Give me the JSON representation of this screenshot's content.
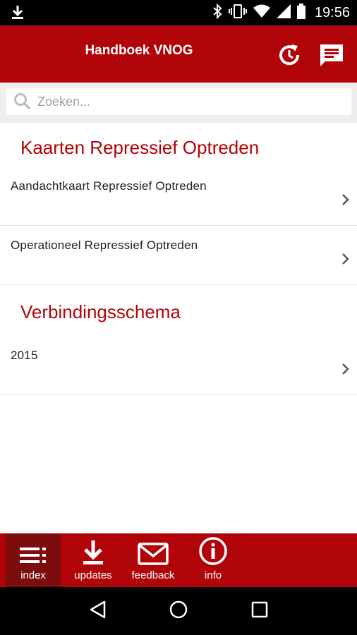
{
  "status_bar": {
    "time": "19:56",
    "icons": [
      "download-icon",
      "bluetooth-icon",
      "vibrate-icon",
      "wifi-icon",
      "signal-icon",
      "battery-icon"
    ]
  },
  "app_bar": {
    "title": "Handboek VNOG",
    "actions": [
      "refresh-history-icon",
      "chat-icon"
    ]
  },
  "search": {
    "placeholder": "Zoeken..."
  },
  "sections": [
    {
      "title": "Kaarten Repressief Optreden",
      "items": [
        {
          "label": "Aandachtkaart Repressief Optreden"
        },
        {
          "label": "Operationeel Repressief Optreden"
        }
      ]
    },
    {
      "title": "Verbindingsschema",
      "items": [
        {
          "label": "2015"
        }
      ]
    }
  ],
  "tabs": [
    {
      "label": "index",
      "icon": "list-menu-icon",
      "active": true
    },
    {
      "label": "updates",
      "icon": "download-icon",
      "active": false
    },
    {
      "label": "feedback",
      "icon": "mail-icon",
      "active": false
    },
    {
      "label": "info",
      "icon": "info-icon",
      "active": false
    }
  ],
  "nav_bar": [
    "back-icon",
    "home-icon",
    "recents-icon"
  ],
  "colors": {
    "brand": "#b00409",
    "active_tab": "#7c0c0e",
    "section_title": "#b00409"
  }
}
